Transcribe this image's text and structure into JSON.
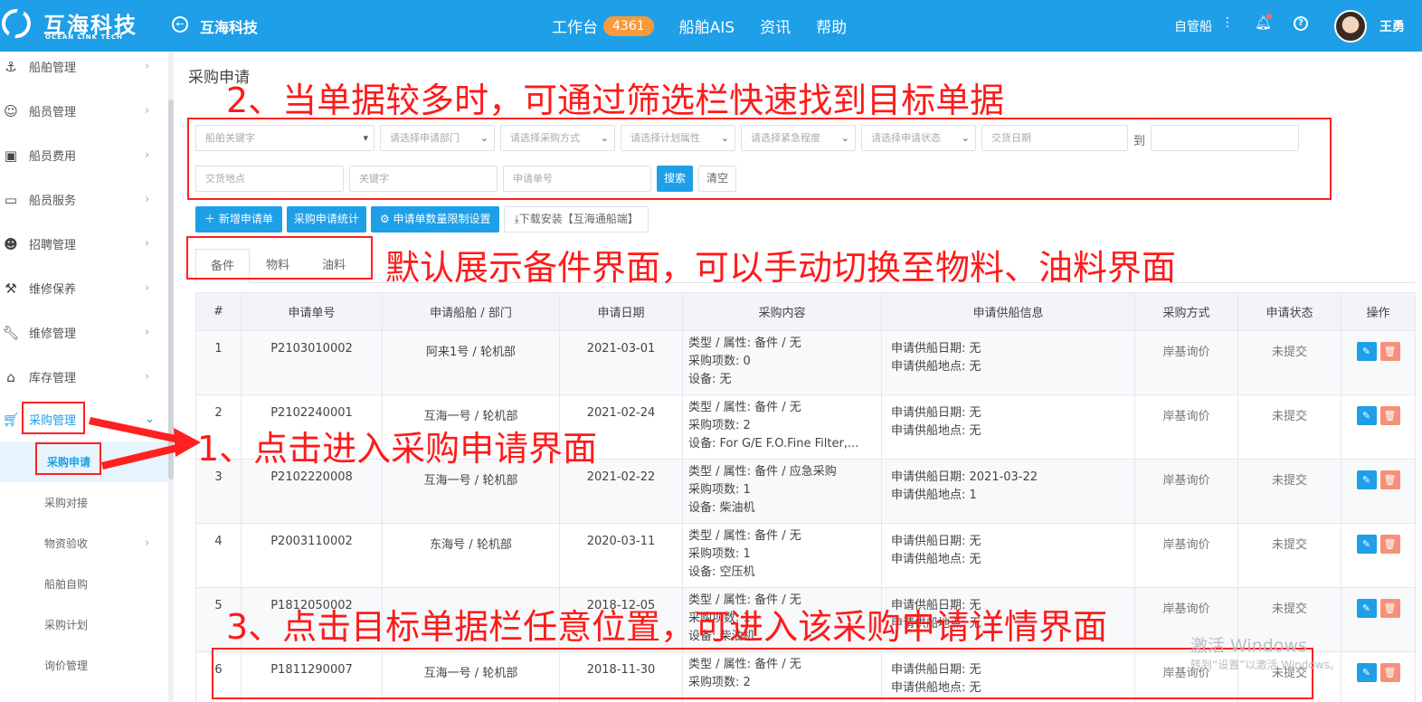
{
  "header": {
    "logo_cn": "互海科技",
    "logo_en": "OCEAN LINK TECH",
    "back_icon": "back-arrow-icon",
    "title": "互海科技",
    "nav": [
      {
        "label": "工作台",
        "badge": "4361"
      },
      {
        "label": "船舶AIS"
      },
      {
        "label": "资讯"
      },
      {
        "label": "帮助"
      }
    ],
    "self_ship": "自管船",
    "user_name": "王勇"
  },
  "sidebar": {
    "items": [
      {
        "label": "船舶管理",
        "icon": "anchor-icon"
      },
      {
        "label": "船员管理",
        "icon": "person-icon"
      },
      {
        "label": "船员费用",
        "icon": "wallet-icon"
      },
      {
        "label": "船员服务",
        "icon": "monitor-icon"
      },
      {
        "label": "招聘管理",
        "icon": "recruit-icon"
      },
      {
        "label": "维修保养",
        "icon": "tool-icon"
      },
      {
        "label": "维修管理",
        "icon": "wrench-icon"
      },
      {
        "label": "库存管理",
        "icon": "home-icon"
      },
      {
        "label": "采购管理",
        "icon": "cart-icon"
      }
    ],
    "sub_items": [
      {
        "label": "采购申请"
      },
      {
        "label": "采购对接"
      },
      {
        "label": "物资验收"
      },
      {
        "label": "船舶自购"
      },
      {
        "label": "采购计划"
      },
      {
        "label": "询价管理"
      }
    ]
  },
  "page": {
    "title": "采购申请"
  },
  "filters": {
    "ship_keyword": "船舶关键字",
    "dept": "请选择申请部门",
    "method": "请选择采购方式",
    "plan_attr": "请选择计划属性",
    "urgency": "请选择紧急程度",
    "status": "请选择申请状态",
    "delivery_date": "交货日期",
    "to": "到",
    "delivery_place": "交货地点",
    "keyword": "关键字",
    "apply_no": "申请单号",
    "search": "搜索",
    "clear": "清空"
  },
  "actions": {
    "new": "新增申请单",
    "stats": "采购申请统计",
    "limit": "申请单数量限制设置",
    "download": "下载安装【互海通船端】"
  },
  "tabs": [
    "备件",
    "物料",
    "油料"
  ],
  "table": {
    "headers": [
      "#",
      "申请单号",
      "申请船舶 / 部门",
      "申请日期",
      "采购内容",
      "申请供船信息",
      "采购方式",
      "申请状态",
      "操作"
    ],
    "rows": [
      {
        "idx": "1",
        "no": "P2103010002",
        "ship": "阿来1号 / 轮机部",
        "date": "2021-03-01",
        "content": [
          "类型 / 属性:  备件 / 无",
          "采购项数:  0",
          "设备:  无"
        ],
        "supply": [
          "申请供船日期:  无",
          "申请供船地点:  无"
        ],
        "method": "岸基询价",
        "status": "未提交"
      },
      {
        "idx": "2",
        "no": "P2102240001",
        "ship": "互海一号 / 轮机部",
        "date": "2021-02-24",
        "content": [
          "类型 / 属性:  备件 / 无",
          "采购项数:  2",
          "设备:   For G/E F.O.Fine Filter,..."
        ],
        "supply": [
          "申请供船日期:  无",
          "申请供船地点:  无"
        ],
        "method": "岸基询价",
        "status": "未提交"
      },
      {
        "idx": "3",
        "no": "P2102220008",
        "ship": "互海一号 / 轮机部",
        "date": "2021-02-22",
        "content": [
          "类型 / 属性:  备件 / 应急采购",
          "采购项数:  1",
          "设备:  柴油机"
        ],
        "supply": [
          "申请供船日期:  2021-03-22",
          "申请供船地点:  1"
        ],
        "method": "岸基询价",
        "status": "未提交"
      },
      {
        "idx": "4",
        "no": "P2003110002",
        "ship": "东海号 / 轮机部",
        "date": "2020-03-11",
        "content": [
          "类型 / 属性:  备件 / 无",
          "采购项数:  1",
          "设备:  空压机"
        ],
        "supply": [
          "申请供船日期:  无",
          "申请供船地点:  无"
        ],
        "method": "岸基询价",
        "status": "未提交"
      },
      {
        "idx": "5",
        "no": "P1812050002",
        "ship": "",
        "date": "2018-12-05",
        "content": [
          "类型 / 属性:  备件 / 无",
          "采购项数:  1",
          "设备:  柴油机"
        ],
        "supply": [
          "申请供船日期:  无",
          "申请供船地点:  无"
        ],
        "method": "岸基询价",
        "status": "未提交"
      },
      {
        "idx": "6",
        "no": "P1811290007",
        "ship": "互海一号 / 轮机部",
        "date": "2018-11-30",
        "content": [
          "类型 / 属性:  备件 / 无",
          "采购项数:  2",
          ""
        ],
        "supply": [
          "申请供船日期:  无",
          "申请供船地点:  无"
        ],
        "method": "岸基询价",
        "status": "未提交"
      }
    ]
  },
  "annotations": {
    "a1": "1、点击进入采购申请界面",
    "a2": "2、当单据较多时，可通过筛选栏快速找到目标单据",
    "a3": "3、点击目标单据栏任意位置，可进入该采购申请详情界面",
    "tabs_note": "默认展示备件界面，可以手动切换至物料、油料界面"
  },
  "watermark": {
    "line1": "激活 Windows",
    "line2": "转到“设置”以激活 Windows。"
  },
  "colors": {
    "primary": "#1e9fe8",
    "annotation": "#ff2020",
    "badge": "#f79a3a",
    "delete": "#f5917a"
  }
}
